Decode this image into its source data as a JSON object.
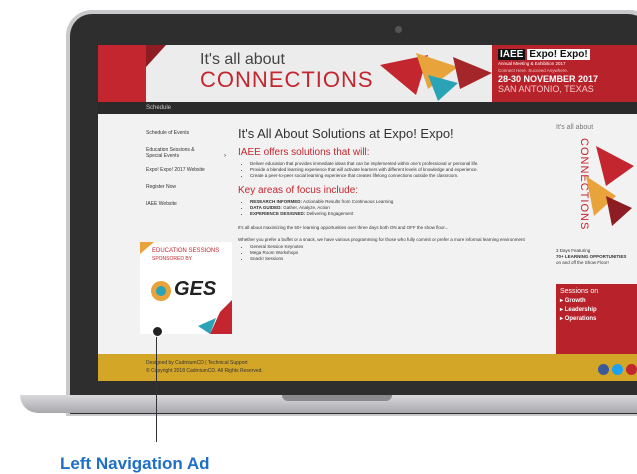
{
  "site": {
    "banner": {
      "tagline_small": "It's all about",
      "tagline_big": "CONNECTIONS",
      "logo_left": "IAEE",
      "logo_right": "Expo! Expo!",
      "logo_sub": "Annual Meeting & Exhibition 2017",
      "slogan": "Connect Here. Succeed Anywhere.",
      "dates": "28-30 NOVEMBER 2017",
      "location": "SAN ANTONIO, TEXAS"
    },
    "nav": {
      "item": "Schedule"
    },
    "sidebar": {
      "items": [
        {
          "label": "Schedule of Events"
        },
        {
          "label": "Education Sessions & Special Events"
        },
        {
          "label": "Expo! Expo! 2017 Website"
        },
        {
          "label": "Register Now"
        },
        {
          "label": "IAEE Website"
        }
      ],
      "ad": {
        "line1": "EDUCATION SESSIONS",
        "line2": "SPONSORED BY",
        "brand": "GES"
      }
    },
    "main": {
      "heading": "It's All About Solutions at Expo! Expo!",
      "subheading": "IAEE offers solutions that will:",
      "bullets": [
        "Deliver education that provides immediate ideas that can be implemented within one's professional or personal life.",
        "Provide a blended learning experience that will activate learners with different levels of knowledge and experience.",
        "Create a peer-to-peer social learning experience that creates lifelong connections outside the classroom."
      ],
      "focus_heading": "Key areas of focus include:",
      "focus": [
        {
          "key": "RESEARCH INFORMED:",
          "text": "Actionable Results from Continuous Learning"
        },
        {
          "key": "DATA GUIDED:",
          "text": "Gather, Analyze, Action"
        },
        {
          "key": "EXPERIENCE DESIGNED:",
          "text": "Delivering Engagement"
        }
      ],
      "para1": "It's all about maximizing the 50+ learning opportunities over three days both ON and OFF the show floor...",
      "para2": "Whether you prefer a buffet or a snack, we have various programming for those who fully commit or prefer a more informal learning environment",
      "sub_bullets": [
        "General Session Keynotes",
        "Mega Room Workshops",
        "Snack! Sessions"
      ]
    },
    "right_ad": {
      "small": "It's all about",
      "vertical": "CONNECTIONS",
      "days_line": "3 Days Featuring",
      "count": "70+ LEARNING OPPORTUNITIES",
      "suffix": "on and off the Show Floor!",
      "sessions_title": "Sessions on",
      "sessions": [
        "Growth",
        "Leadership",
        "Operations"
      ]
    },
    "footer": {
      "links": "Designed by CadmiumCD | Technical Support",
      "copyright": "© Copyright 2018 CadmiumCD. All Rights Reserved."
    }
  },
  "caption": "Left Navigation Ad",
  "colors": {
    "brand_red": "#c3262e",
    "footer_gold": "#d4a628",
    "caption_blue": "#1f6fc7"
  }
}
